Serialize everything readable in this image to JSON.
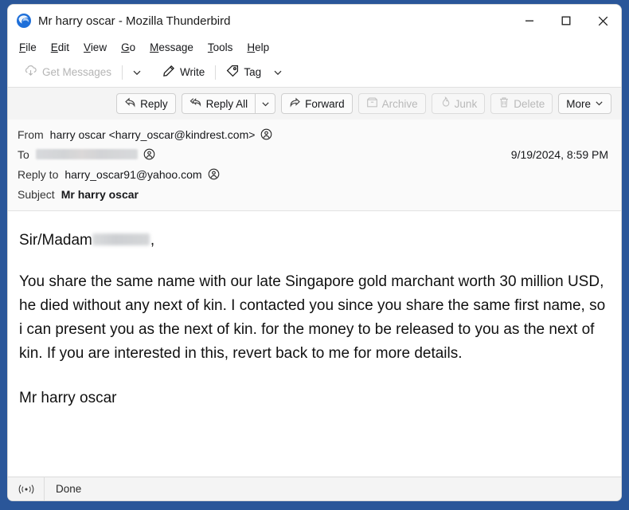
{
  "window": {
    "title": "Mr harry oscar - Mozilla Thunderbird",
    "logo_icon": "thunderbird-logo-icon",
    "controls": [
      {
        "name": "minimize-button",
        "icon": "minimize-icon",
        "label": "Minimize"
      },
      {
        "name": "maximize-button",
        "icon": "maximize-icon",
        "label": "Maximize"
      },
      {
        "name": "close-button",
        "icon": "close-icon",
        "label": "Close"
      }
    ]
  },
  "menu_bar": {
    "items": [
      {
        "label": "File",
        "accesskey": "F"
      },
      {
        "label": "Edit",
        "accesskey": "E"
      },
      {
        "label": "View",
        "accesskey": "V"
      },
      {
        "label": "Go",
        "accesskey": "G"
      },
      {
        "label": "Message",
        "accesskey": "M"
      },
      {
        "label": "Tools",
        "accesskey": "T"
      },
      {
        "label": "Help",
        "accesskey": "H"
      }
    ]
  },
  "main_toolbar": {
    "get_messages": {
      "label": "Get Messages",
      "icon": "download-cloud-icon",
      "disabled": true
    },
    "get_messages_chevron": {
      "icon": "chevron-down-icon"
    },
    "write": {
      "label": "Write",
      "icon": "pencil-icon",
      "disabled": false
    },
    "tag": {
      "label": "Tag",
      "icon": "tag-icon",
      "disabled": false
    },
    "tag_chevron": {
      "icon": "chevron-down-icon"
    }
  },
  "message_toolbar": {
    "reply": {
      "label": "Reply",
      "icon": "reply-arrow-icon",
      "disabled": false
    },
    "reply_all": {
      "label": "Reply All",
      "icon": "reply-all-arrow-icon",
      "disabled": false
    },
    "reply_all_chevron": {
      "icon": "chevron-down-icon"
    },
    "forward": {
      "label": "Forward",
      "icon": "forward-arrow-icon",
      "disabled": false
    },
    "archive": {
      "label": "Archive",
      "icon": "archive-box-icon",
      "disabled": true
    },
    "junk": {
      "label": "Junk",
      "icon": "flame-icon",
      "disabled": true
    },
    "delete": {
      "label": "Delete",
      "icon": "trash-icon",
      "disabled": true
    },
    "more": {
      "label": "More",
      "icon": "chevron-down-icon",
      "disabled": false
    }
  },
  "headers": {
    "from": {
      "label": "From",
      "value": "harry oscar <harry_oscar@kindrest.com>",
      "contact_icon": "contact-person-icon"
    },
    "to": {
      "label": "To",
      "value": "",
      "redacted": true,
      "contact_icon": "contact-person-icon"
    },
    "reply_to": {
      "label": "Reply to",
      "value": "harry_oscar91@yahoo.com",
      "contact_icon": "contact-person-icon"
    },
    "subject": {
      "label": "Subject",
      "value": "Mr harry oscar"
    },
    "date": "9/19/2024, 8:59 PM"
  },
  "body": {
    "greeting_prefix": "Sir/Madam",
    "greeting_suffix": ",",
    "paragraph": "You share the same name with our late Singapore gold marchant worth 30 million USD, he died without any next of kin. I contacted you since you share the same first name, so i can present you as the next of kin. for the money to be released to you as the next of kin. If you are interested in this, revert back to me for more details.",
    "signature": "Mr  harry oscar"
  },
  "status_bar": {
    "icon": "broadcast-signal-icon",
    "text": "Done"
  },
  "colors": {
    "desktop": "#2a5699",
    "window_bg": "#ffffff",
    "toolbar_bg": "#f4f4f4",
    "header_bg": "#fafafa",
    "accent": "#2a5699",
    "disabled_text": "#b5b5b5",
    "text": "#16171a"
  }
}
